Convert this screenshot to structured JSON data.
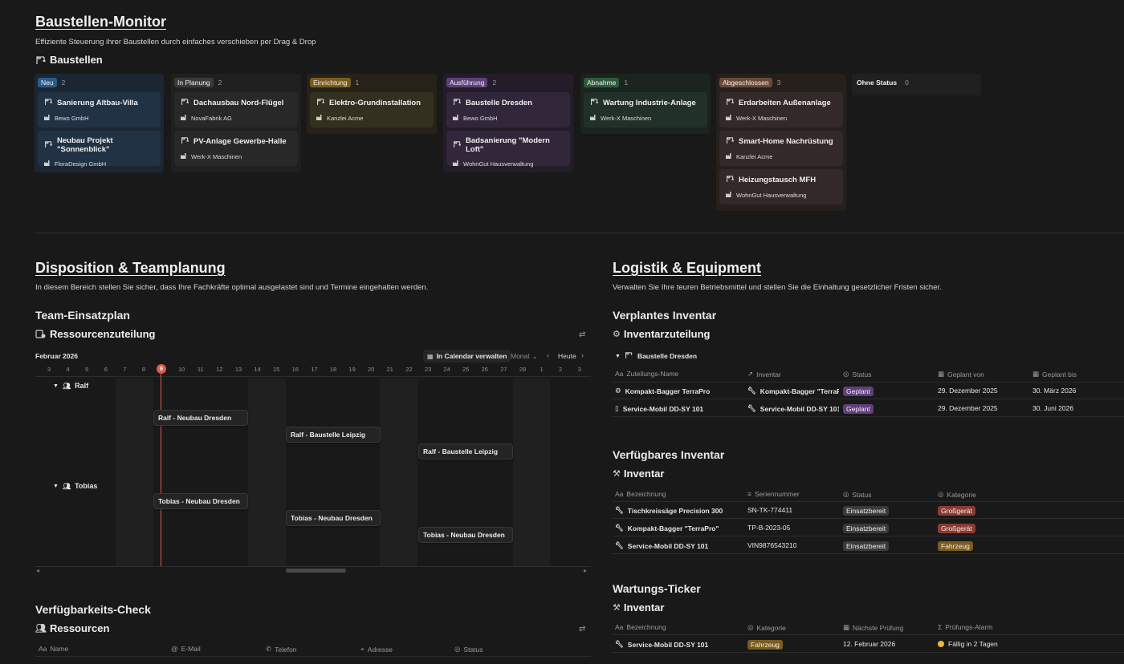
{
  "header": {
    "title": "Baustellen-Monitor",
    "description": "Effiziente Steuerung ihrer Baustellen durch einfaches verschieben per Drag & Drop",
    "db_title": "Baustellen"
  },
  "board": {
    "columns": [
      {
        "label": "Neu",
        "count": "2",
        "color": "#2a5c8a",
        "bg": "#1c2633",
        "cardbg": "#213245",
        "cards": [
          {
            "title": "Sanierung Altbau-Villa",
            "sub": "Bewo GmbH"
          },
          {
            "title": "Neubau Projekt \"Sonnenblick\"",
            "sub": "FloraDesign GmbH"
          }
        ]
      },
      {
        "label": "In Planung",
        "count": "2",
        "color": "#3a3a3a",
        "bg": "#202020",
        "cardbg": "#282828",
        "cards": [
          {
            "title": "Dachausbau Nord-Flügel",
            "sub": "NovaFabrik AG"
          },
          {
            "title": "PV-Anlage Gewerbe-Halle",
            "sub": "Werk-X Maschinen"
          }
        ]
      },
      {
        "label": "Einrichtung",
        "count": "1",
        "color": "#7a5c1e",
        "bg": "#26221a",
        "cardbg": "#33301f",
        "cards": [
          {
            "title": "Elektro-Grundinstallation",
            "sub": "Kanzlei Acme"
          }
        ]
      },
      {
        "label": "Ausführung",
        "count": "2",
        "color": "#5e3f7a",
        "bg": "#241d29",
        "cardbg": "#32273a",
        "cards": [
          {
            "title": "Baustelle Dresden",
            "sub": "Bewo GmbH"
          },
          {
            "title": "Badsanierung \"Modern Loft\"",
            "sub": "WohnGut Hausverwaltung"
          }
        ]
      },
      {
        "label": "Abnahme",
        "count": "1",
        "color": "#2e5a3c",
        "bg": "#1b241e",
        "cardbg": "#223128",
        "cards": [
          {
            "title": "Wartung Industrie-Anlage",
            "sub": "Werk-X Maschinen"
          }
        ]
      },
      {
        "label": "Abgeschlossen",
        "count": "3",
        "color": "#6a4a36",
        "bg": "#26201c",
        "cardbg": "#33292a",
        "cards": [
          {
            "title": "Erdarbeiten Außenanlage",
            "sub": "Werk-X Maschinen"
          },
          {
            "title": "Smart-Home Nachrüstung",
            "sub": "Kanzlei Acme"
          },
          {
            "title": "Heizungstausch MFH",
            "sub": "WohnGut Hausverwaltung"
          }
        ]
      },
      {
        "label": "Ohne Status",
        "count": "0",
        "color": "",
        "bg": "#202020",
        "cardbg": "#282828",
        "cards": []
      }
    ]
  },
  "dispo": {
    "title": "Disposition & Teamplanung",
    "description": "In diesem Bereich stellen Sie sicher, dass Ihre Fachkräfte optimal ausgelastet sind und Termine eingehalten werden.",
    "section": "Team-Einsatzplan",
    "db_title": "Ressourcenzuteilung",
    "month": "Februar 2026",
    "calendar_btn": "In Calendar verwalten",
    "view_select": "Monat",
    "today_btn": "Heute",
    "days": [
      "3",
      "4",
      "5",
      "6",
      "7",
      "8",
      "9",
      "10",
      "11",
      "12",
      "13",
      "14",
      "15",
      "16",
      "17",
      "18",
      "19",
      "20",
      "21",
      "22",
      "23",
      "24",
      "25",
      "26",
      "27",
      "28",
      "1",
      "2",
      "3"
    ],
    "today": "9",
    "groups": [
      "Ralf",
      "Tobias"
    ],
    "bars": [
      {
        "label": "Ralf - Neubau Dresden"
      },
      {
        "label": "Ralf - Baustelle Leipzig"
      },
      {
        "label": "Ralf - Baustelle Leipzig"
      },
      {
        "label": "Tobias - Neubau Dresden"
      },
      {
        "label": "Tobias - Neubau Dresden"
      },
      {
        "label": "Tobias - Neubau Dresden"
      }
    ],
    "availability_title": "Verfügbarkeits-Check",
    "availability_db": "Ressourcen",
    "availability_headers": [
      "Name",
      "E-Mail",
      "Telefon",
      "Adresse",
      "Status"
    ]
  },
  "logistik": {
    "title": "Logistik & Equipment",
    "description": "Verwalten Sie Ihre teuren Betriebsmittel und stellen Sie die Einhaltung gesetzlicher Fristen sicher.",
    "planned_title": "Verplantes Inventar",
    "planned_db": "Inventarzuteilung",
    "planned_group": "Baustelle Dresden",
    "planned_headers": [
      "Zuteilungs-Name",
      "Inventar",
      "Status",
      "Geplant von",
      "Geplant bis"
    ],
    "planned_rows": [
      {
        "name": "Kompakt-Bagger TerraPro",
        "inventar": "Kompakt-Bagger \"TerraPro\"",
        "status": "Geplant",
        "von": "29. Dezember 2025",
        "bis": "30. März 2026"
      },
      {
        "name": "Service-Mobil DD-SY 101",
        "inventar": "Service-Mobil DD-SY 101",
        "status": "Geplant",
        "von": "29. Dezember 2025",
        "bis": "30. Juni 2026"
      }
    ],
    "available_title": "Verfügbares Inventar",
    "available_db": "Inventar",
    "available_headers": [
      "Bezeichnung",
      "Seriennummer",
      "Status",
      "Kategorie"
    ],
    "available_rows": [
      {
        "name": "Tischkreissäge Precision 300",
        "serial": "SN-TK-774411",
        "status": "Einsatzbereit",
        "kategorie": "Großgerät"
      },
      {
        "name": "Kompakt-Bagger \"TerraPro\"",
        "serial": "TP-B-2023-05",
        "status": "Einsatzbereit",
        "kategorie": "Großgerät"
      },
      {
        "name": "Service-Mobil DD-SY 101",
        "serial": "VIN9876543210",
        "status": "Einsatzbereit",
        "kategorie": "Fahrzeug"
      }
    ],
    "ticker_title": "Wartungs-Ticker",
    "ticker_db": "Inventar",
    "ticker_headers": [
      "Bezeichnung",
      "Kategorie",
      "Nächste Prüfung",
      "Prüfungs-Alarm"
    ],
    "ticker_rows": [
      {
        "name": "Service-Mobil DD-SY 101",
        "kategorie": "Fahrzeug",
        "pruefung": "12. Februar 2026",
        "alarm": "Fällig in 2 Tagen"
      }
    ]
  },
  "colors": {
    "geplant": "#5e3f7a",
    "einsatzbereit": "#3a3a3a",
    "grossgeraet": "#8a3a32",
    "fahrzeug": "#7a5c1e",
    "today": "#e05a4a"
  }
}
